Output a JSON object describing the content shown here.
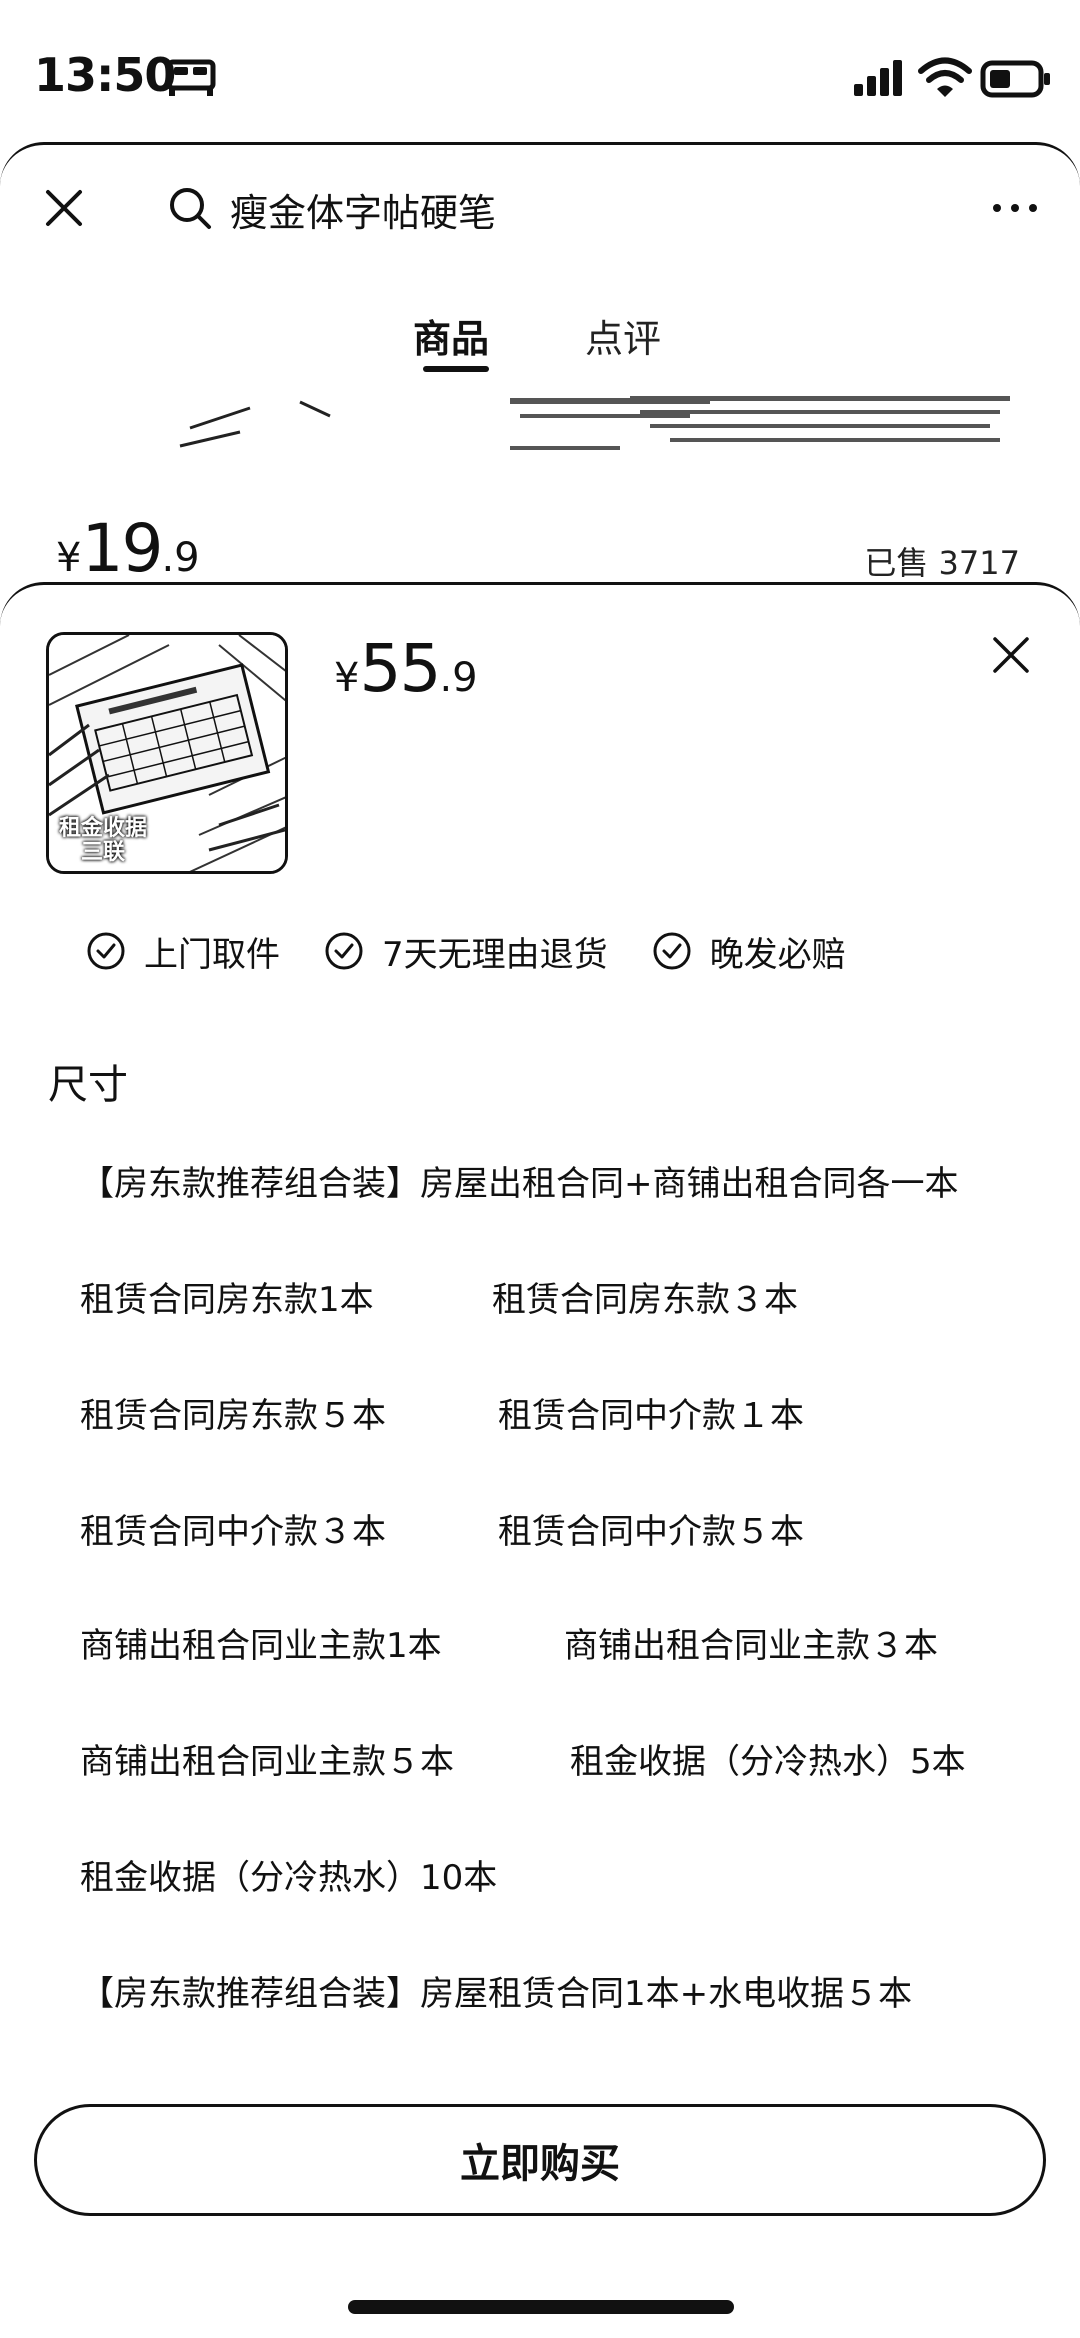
{
  "status_bar": {
    "time": "13:50",
    "icons": [
      "bed-icon",
      "signal-icon",
      "wifi-icon",
      "battery-icon"
    ]
  },
  "header": {
    "search_text": "瘦金体字帖硬笔",
    "icons": [
      "close-icon",
      "search-icon",
      "more-icon"
    ]
  },
  "tabs": [
    {
      "label": "商品",
      "active": true
    },
    {
      "label": "点评",
      "active": false
    }
  ],
  "listing": {
    "price_currency": "¥",
    "price_int": "19",
    "price_dec": ".9",
    "sold": "已售 3717"
  },
  "sheet": {
    "thumbnail_caption": "租金收据 三联",
    "price_currency": "¥",
    "price_int": "55",
    "price_dec": ".9",
    "guarantees": [
      "上门取件",
      "7天无理由退货",
      "晚发必赔"
    ],
    "size_title": "尺寸",
    "options": [
      "【房东款推荐组合装】房屋出租合同+商铺出租合同各一本",
      "租赁合同房东款1本",
      "租赁合同房东款３本",
      "租赁合同房东款５本",
      "租赁合同中介款１本",
      "租赁合同中介款３本",
      "租赁合同中介款５本",
      "商铺出租合同业主款1本",
      "商铺出租合同业主款３本",
      "商铺出租合同业主款５本",
      "租金收据（分冷热水）5本",
      "租金收据（分冷热水）10本",
      "【房东款推荐组合装】房屋租赁合同1本+水电收据５本"
    ],
    "buy_label": "立即购买"
  },
  "colors": {
    "ink": "#111111",
    "background": "#ffffff"
  }
}
